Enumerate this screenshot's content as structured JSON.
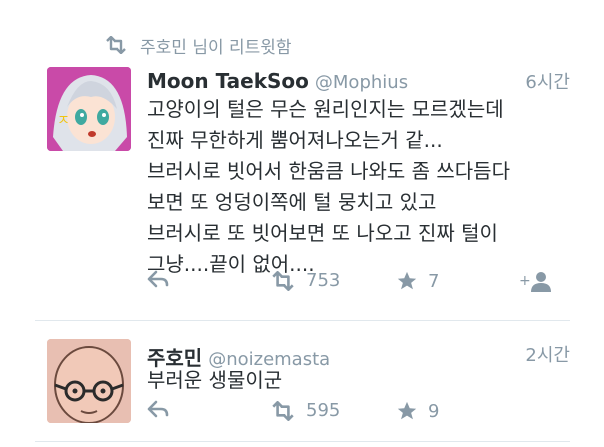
{
  "retweet_context": {
    "icon": "retweet-icon",
    "text": "주호민 님이 리트윗함"
  },
  "tweets": [
    {
      "avatar": "anime-girl-avatar",
      "name": "Moon TaekSoo",
      "handle": "@Mophius",
      "time": "6시간",
      "text": "고양이의 털은 무슨 원리인지는 모르겠는데\n진짜 무한하게 뿜어져나오는거 같...\n브러시로 빗어서 한움큼 나와도 좀 쓰다듬다\n보면 또 엉덩이쪽에 털 뭉치고 있고\n브러시로 또 빗어보면 또 나오고 진짜 털이\n그냥....끝이 없어....",
      "retweets": "753",
      "favorites": "7",
      "icons": {
        "reply": "reply-icon",
        "retweet": "retweet-icon",
        "favorite": "star-icon",
        "follow": "follow-icon"
      }
    },
    {
      "avatar": "bald-man-avatar",
      "name": "주호민",
      "handle": "@noizemasta",
      "time": "2시간",
      "text": "부러운 생물이군",
      "retweets": "595",
      "favorites": "9",
      "icons": {
        "reply": "reply-icon",
        "retweet": "retweet-icon",
        "favorite": "star-icon"
      }
    }
  ],
  "colors": {
    "text": "#292f33",
    "muted": "#8899a6",
    "divider": "#e1e8ed"
  }
}
